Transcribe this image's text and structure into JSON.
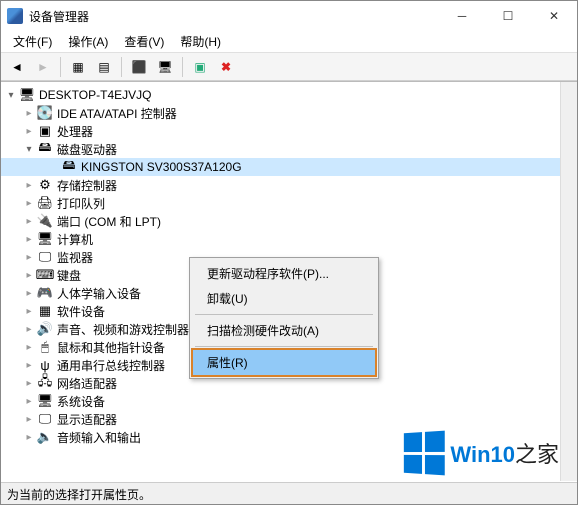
{
  "window": {
    "title": "设备管理器"
  },
  "menu": {
    "file": "文件(F)",
    "action": "操作(A)",
    "view": "查看(V)",
    "help": "帮助(H)"
  },
  "tree": {
    "root": "DESKTOP-T4EJVJQ",
    "nodes": [
      {
        "label": "IDE ATA/ATAPI 控制器"
      },
      {
        "label": "处理器"
      },
      {
        "label": "磁盘驱动器",
        "expanded": true,
        "children": [
          {
            "label": "KINGSTON SV300S37A120G"
          }
        ]
      },
      {
        "label": "存储控制器"
      },
      {
        "label": "打印队列"
      },
      {
        "label": "端口 (COM 和 LPT)"
      },
      {
        "label": "计算机"
      },
      {
        "label": "监视器"
      },
      {
        "label": "键盘"
      },
      {
        "label": "人体学输入设备"
      },
      {
        "label": "软件设备"
      },
      {
        "label": "声音、视频和游戏控制器"
      },
      {
        "label": "鼠标和其他指针设备"
      },
      {
        "label": "通用串行总线控制器"
      },
      {
        "label": "网络适配器"
      },
      {
        "label": "系统设备"
      },
      {
        "label": "显示适配器"
      },
      {
        "label": "音频输入和输出"
      }
    ]
  },
  "context_menu": {
    "update_driver": "更新驱动程序软件(P)...",
    "uninstall": "卸载(U)",
    "scan": "扫描检测硬件改动(A)",
    "properties": "属性(R)"
  },
  "statusbar": "为当前的选择打开属性页。",
  "watermark": {
    "brand": "Win10",
    "suffix": "之家"
  }
}
